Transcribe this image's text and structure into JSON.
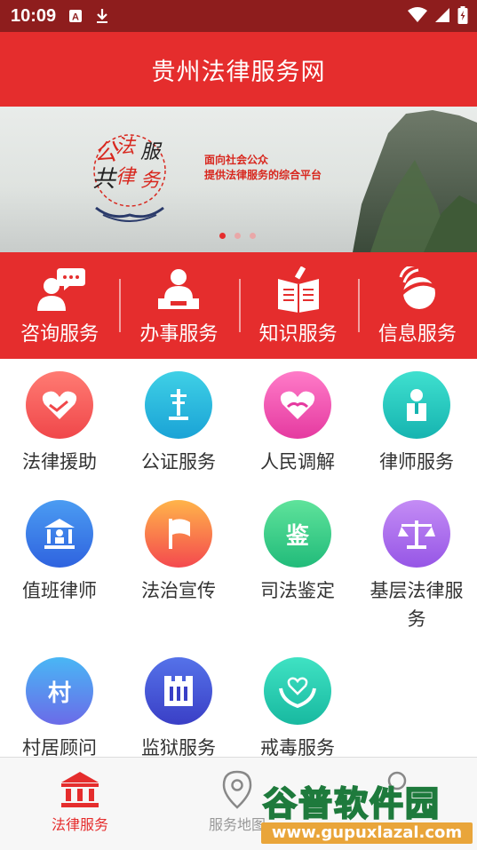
{
  "status_bar": {
    "time": "10:09",
    "icons": [
      "a-notification-icon",
      "download-icon",
      "wifi-icon",
      "signal-icon",
      "battery-icon"
    ]
  },
  "header": {
    "title": "贵州法律服务网"
  },
  "banner": {
    "logo_text": "公共法律服务",
    "slogan_line1": "面向社会公众",
    "slogan_line2": "提供法律服务的综合平台",
    "page_count": 3,
    "active_page": 1
  },
  "service_strip": [
    {
      "label": "咨询服务",
      "icon": "consult-icon"
    },
    {
      "label": "办事服务",
      "icon": "affairs-icon"
    },
    {
      "label": "知识服务",
      "icon": "knowledge-icon"
    },
    {
      "label": "信息服务",
      "icon": "info-icon"
    }
  ],
  "grid": [
    {
      "label": "法律援助",
      "icon": "heart-hands-icon",
      "glyph": "",
      "color_top": "#ff7b73",
      "color_bottom": "#f0474a"
    },
    {
      "label": "公证服务",
      "icon": "notary-icon",
      "glyph": "",
      "color_top": "#3fd0e6",
      "color_bottom": "#1aa3d6"
    },
    {
      "label": "人民调解",
      "icon": "mediation-icon",
      "glyph": "",
      "color_top": "#ff7bc8",
      "color_bottom": "#e53aa0"
    },
    {
      "label": "律师服务",
      "icon": "lawyer-icon",
      "glyph": "",
      "color_top": "#3fe0cf",
      "color_bottom": "#16b4b0"
    },
    {
      "label": "值班律师",
      "icon": "court-icon",
      "glyph": "",
      "color_top": "#4b9cf2",
      "color_bottom": "#2f63df"
    },
    {
      "label": "法治宣传",
      "icon": "flag-icon",
      "glyph": "",
      "color_top": "#ffb44a",
      "color_bottom": "#f4494e"
    },
    {
      "label": "司法鉴定",
      "icon": "appraisal-icon",
      "glyph": "鉴",
      "color_top": "#5fe39b",
      "color_bottom": "#21bb7a"
    },
    {
      "label": "基层法律服务",
      "icon": "scales-icon",
      "glyph": "",
      "color_top": "#c48cf5",
      "color_bottom": "#9656e6"
    },
    {
      "label": "村居顾问",
      "icon": "village-icon",
      "glyph": "村",
      "color_top": "#49b7f5",
      "color_bottom": "#6b6be8"
    },
    {
      "label": "监狱服务",
      "icon": "prison-icon",
      "glyph": "",
      "color_top": "#5572e9",
      "color_bottom": "#3a3fc6"
    },
    {
      "label": "戒毒服务",
      "icon": "rehab-icon",
      "glyph": "",
      "color_top": "#3fe2c3",
      "color_bottom": "#18b9a0"
    }
  ],
  "bottom_nav": [
    {
      "label": "法律服务",
      "icon": "bank-icon",
      "active": true
    },
    {
      "label": "服务地图",
      "icon": "map-pin-icon",
      "active": false
    },
    {
      "label": "",
      "icon": "profile-icon",
      "active": false
    }
  ],
  "watermark": {
    "title": "谷普软件园",
    "url": "www.gupuxlazal.com"
  },
  "colors": {
    "primary_red": "#e52d2d",
    "status_bar": "#8e1d1d",
    "active_nav": "#e52d2d",
    "inactive_nav": "#999999"
  }
}
